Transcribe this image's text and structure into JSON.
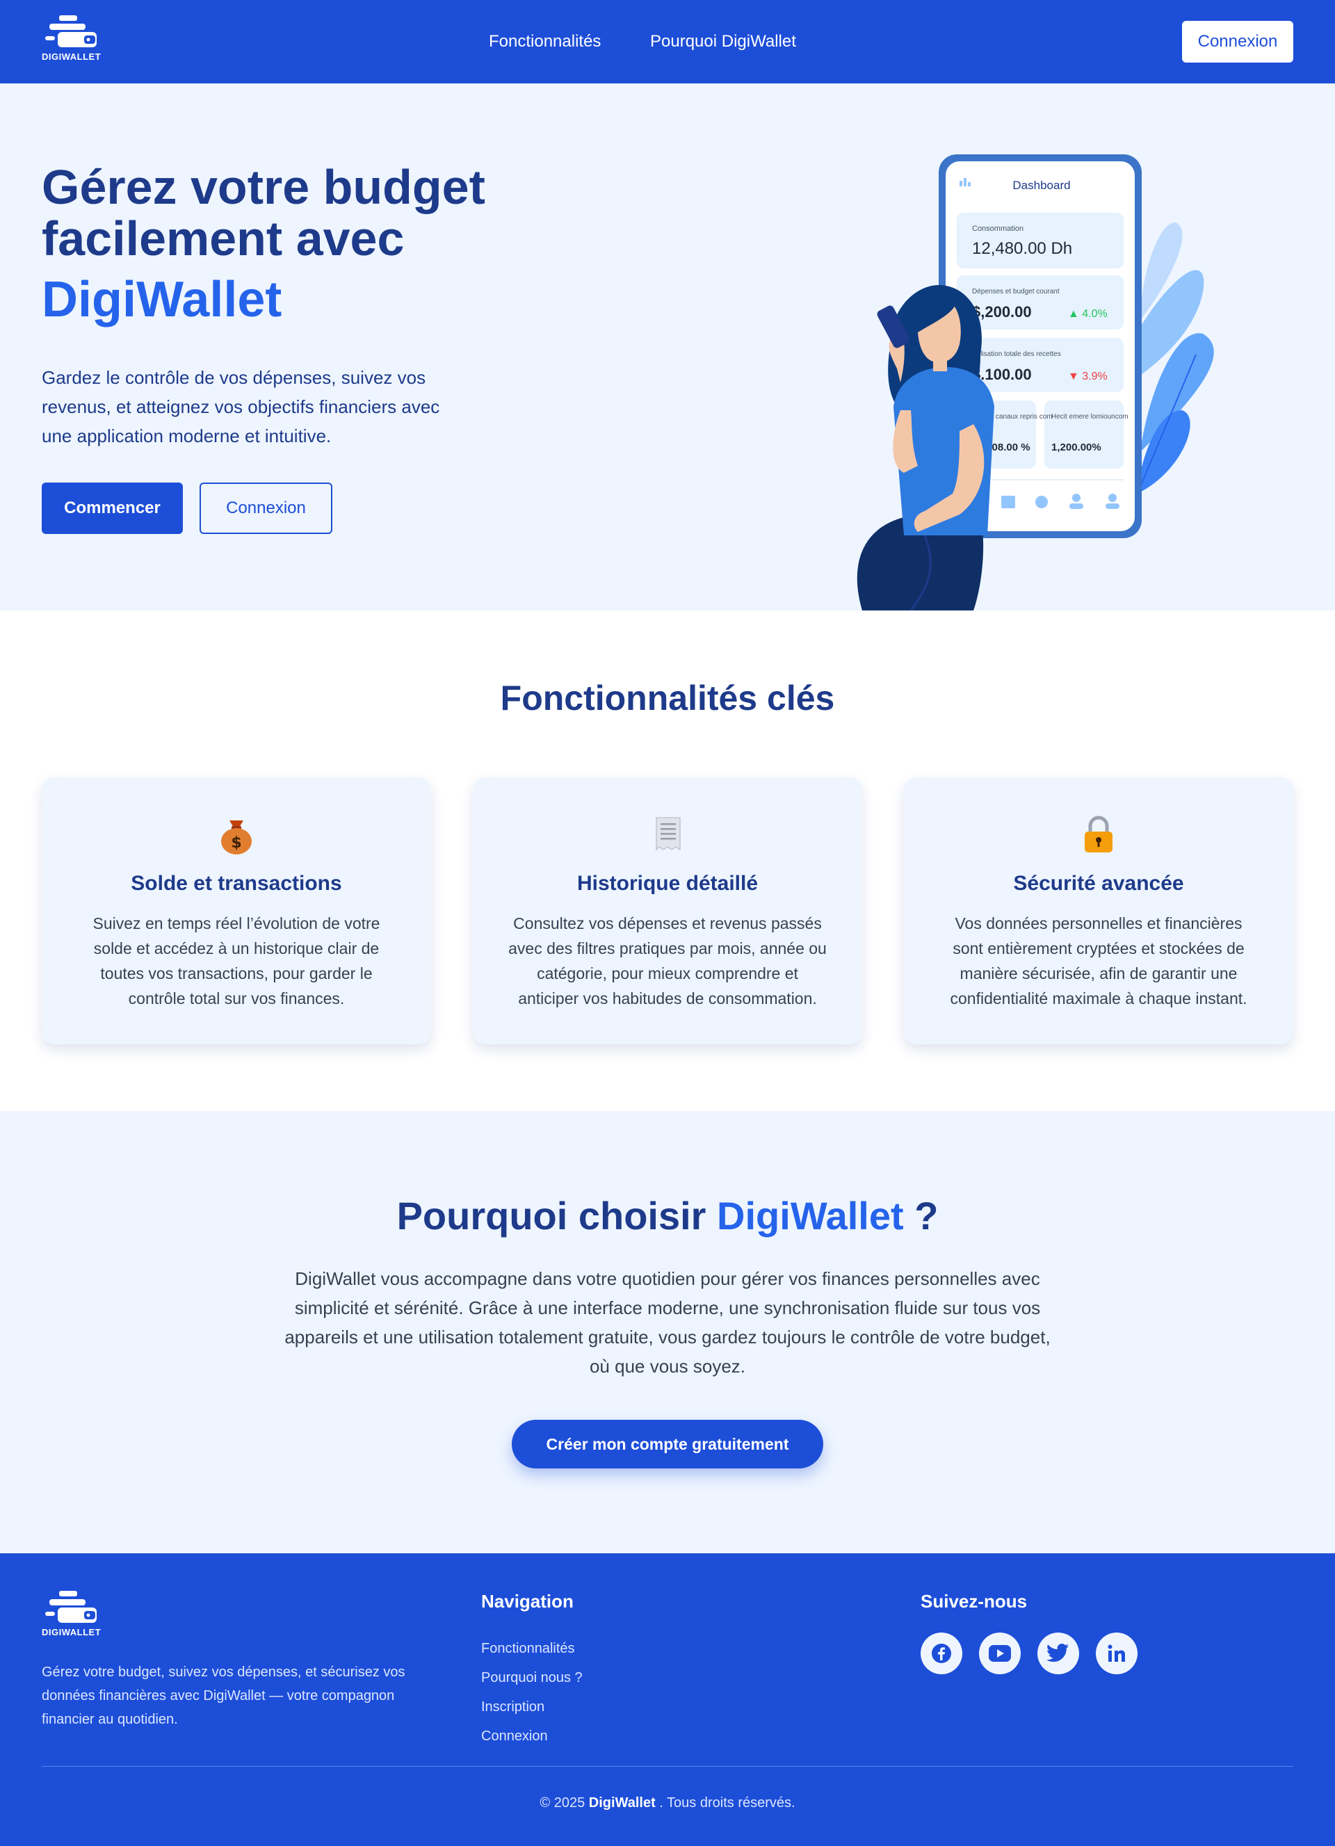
{
  "brand": {
    "logo_text": "DIGIWALLET",
    "name": "DigiWallet"
  },
  "colors": {
    "primary": "#1d4ed8",
    "accent": "#2563eb",
    "navy": "#1e3a8a",
    "light_bg": "#eef5ff"
  },
  "header": {
    "nav": [
      "Fonctionnalités",
      "Pourquoi DigiWallet"
    ],
    "login_label": "Connexion"
  },
  "hero": {
    "title": "Gérez votre budget facilement avec",
    "brand": "DigiWallet",
    "subtitle": "Gardez le contrôle de vos dépenses, suivez vos revenus, et atteignez vos objectifs financiers avec une application moderne et intuitive.",
    "start_label": "Commencer",
    "login_label": "Connexion",
    "phone": {
      "title": "Dashboard",
      "card1_label": "Consommation",
      "card1_value": "12,480.00 Dh",
      "card2_label": "Dépenses et budget courant",
      "card2_value": "$,200.00",
      "card2_change": "▲ 4.0%",
      "card3_label": "Utilisation totale des recettes",
      "card3_value": "$.100.00",
      "card3_change": "▼ 3.9%",
      "mini1_label": "de canaux repris com",
      "mini1_value": ".708.00 %",
      "mini2_label": "Hecit emere lomiouncom",
      "mini2_value": "1,200.00%"
    }
  },
  "features": {
    "title": "Fonctionnalités clés",
    "cards": [
      {
        "icon": "money-bag-icon",
        "title": "Solde et transactions",
        "desc": "Suivez en temps réel l’évolution de votre solde et accédez à un historique clair de toutes vos transactions, pour garder le contrôle total sur vos finances."
      },
      {
        "icon": "receipt-icon",
        "title": "Historique détaillé",
        "desc": "Consultez vos dépenses et revenus passés avec des filtres pratiques par mois, année ou catégorie, pour mieux comprendre et anticiper vos habitudes de consommation."
      },
      {
        "icon": "lock-icon",
        "title": "Sécurité avancée",
        "desc": "Vos données personnelles et financières sont entièrement cryptées et stockées de manière sécurisée, afin de garantir une confidentialité maximale à chaque instant."
      }
    ]
  },
  "why": {
    "title_prefix": "Pourquoi choisir",
    "title_brand": "DigiWallet",
    "title_suffix": "?",
    "text": "DigiWallet vous accompagne dans votre quotidien pour gérer vos finances personnelles avec simplicité et sérénité. Grâce à une interface moderne, une synchronisation fluide sur tous vos appareils et une utilisation totalement gratuite, vous gardez toujours le contrôle de votre budget, où que vous soyez.",
    "cta_label": "Créer mon compte gratuitement"
  },
  "footer": {
    "desc": "Gérez votre budget, suivez vos dépenses, et sécurisez vos données financières avec DigiWallet — votre compagnon financier au quotidien.",
    "nav_title": "Navigation",
    "nav_links": [
      "Fonctionnalités",
      "Pourquoi nous ?",
      "Inscription",
      "Connexion"
    ],
    "social_title": "Suivez-nous",
    "socials": [
      "facebook-icon",
      "youtube-icon",
      "twitter-icon",
      "linkedin-icon"
    ],
    "copyright_prefix": "© 2025",
    "copyright_brand": "DigiWallet",
    "copyright_suffix": ". Tous droits réservés."
  }
}
